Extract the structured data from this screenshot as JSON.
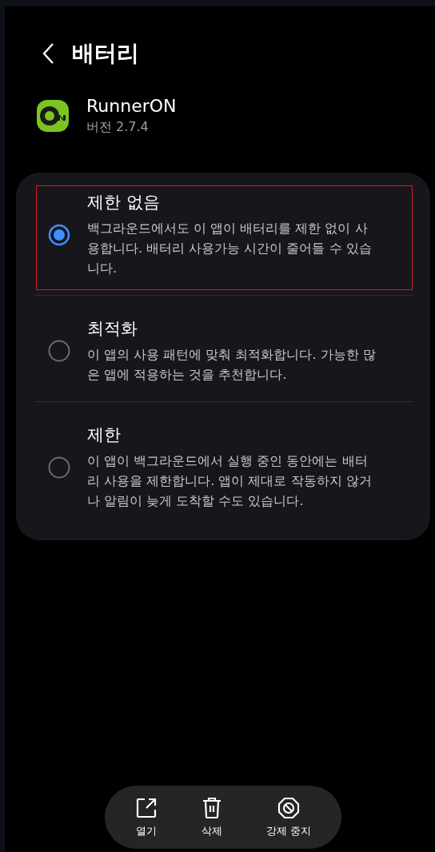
{
  "header": {
    "title": "배터리"
  },
  "app": {
    "name": "RunnerON",
    "version": "버전 2.7.4"
  },
  "options": [
    {
      "title": "제한 없음",
      "description": "백그라운드에서도 이 앱이 배터리를 제한 없이 사용합니다. 배터리 사용가능 시간이 줄어들 수 있습니다.",
      "selected": true,
      "highlighted": true
    },
    {
      "title": "최적화",
      "description": "이 앱의 사용 패턴에 맞춰 최적화합니다. 가능한 많은 앱에 적용하는 것을 추천합니다.",
      "selected": false,
      "highlighted": false
    },
    {
      "title": "제한",
      "description": "이 앱이 백그라운드에서 실행 중인 동안에는 배터리 사용을 제한합니다. 앱이 제대로 작동하지 않거나 알림이 늦게 도착할 수도 있습니다.",
      "selected": false,
      "highlighted": false
    }
  ],
  "actions": [
    {
      "kind": "open",
      "label": "열기"
    },
    {
      "kind": "delete",
      "label": "삭제"
    },
    {
      "kind": "stop",
      "label": "강제 중지"
    }
  ]
}
